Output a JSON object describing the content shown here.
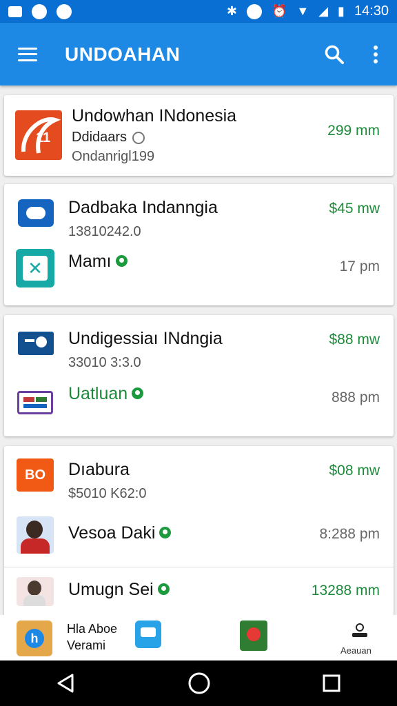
{
  "status": {
    "time": "14:30"
  },
  "appbar": {
    "title": "UNDOAHAN"
  },
  "cards": [
    {
      "rows": [
        {
          "title": "Undowhan INdonesia",
          "line2": "Ddidaars",
          "line3": "Ondanrigl199",
          "meta": "299 mm"
        }
      ]
    },
    {
      "rows": [
        {
          "title": "Dadbaka Indanngia",
          "sub": "13810242.0",
          "meta": "$45 mw"
        },
        {
          "title": "Mamı",
          "meta": "17 pm"
        }
      ]
    },
    {
      "rows": [
        {
          "title": "Undigessiaı INdngia",
          "sub": "33010 3:3.0",
          "meta": "$88 mw"
        },
        {
          "title": "Uatluan",
          "meta": "888 pm"
        }
      ]
    },
    {
      "rows": [
        {
          "title": "Dıabura",
          "sub": "$5010 K62:0",
          "meta": "$08 mw",
          "logo_text": "BO"
        },
        {
          "title": "Vesoa Daki",
          "meta": "8:288 pm"
        },
        {
          "title": "Umugn Sei",
          "meta": "13288 mm"
        }
      ]
    }
  ],
  "bottom": {
    "item1_line1": "Hla Aboe",
    "item1_line2": "Verami",
    "item2": "Aeauan"
  }
}
